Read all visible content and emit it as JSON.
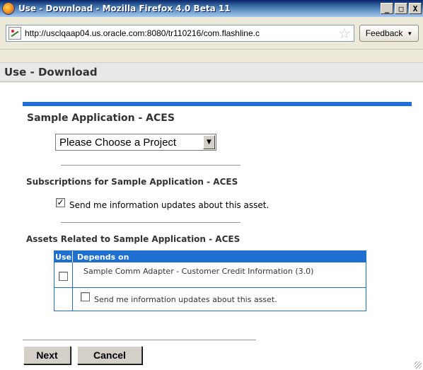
{
  "window": {
    "title": "Use - Download - Mozilla Firefox 4.0 Beta 11",
    "minimize": "_",
    "maximize": "□",
    "close": "X"
  },
  "urlbar": {
    "url": "http://usclqaap04.us.oracle.com:8080/tr110216/com.flashline.c",
    "feedback_label": "Feedback"
  },
  "page": {
    "heading": "Use - Download"
  },
  "asset": {
    "title": "Sample Application - ACES",
    "project_select": "Please Choose a Project"
  },
  "subscriptions": {
    "heading": "Subscriptions for Sample Application - ACES",
    "checkbox_label": "Send me information updates about this asset.",
    "checked": true
  },
  "related": {
    "heading": "Assets Related to Sample Application - ACES",
    "columns": [
      "Use",
      "Depends on"
    ],
    "rows": [
      {
        "name": "Sample Comm Adapter - Customer Credit Information (3.0)",
        "use_checked": false,
        "updates_label": "Send me information updates about this asset.",
        "updates_checked": false
      }
    ]
  },
  "actions": {
    "next_label": "Next",
    "cancel_label": "Cancel"
  },
  "colors": {
    "accent_blue": "#1f6fd0",
    "titlebar": "#0a246a"
  }
}
